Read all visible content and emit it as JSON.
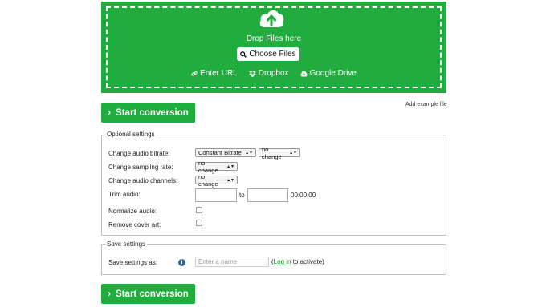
{
  "upload": {
    "drop_label": "Drop Files here",
    "choose_label": "Choose Files",
    "sources": [
      {
        "icon": "link-icon",
        "label": "Enter URL"
      },
      {
        "icon": "dropbox-icon",
        "label": "Dropbox"
      },
      {
        "icon": "google-drive-icon",
        "label": "Google Drive"
      }
    ]
  },
  "start_label": "Start conversion",
  "add_example_label": "Add example file",
  "optional": {
    "legend": "Optional settings",
    "bitrate_label": "Change audio bitrate:",
    "bitrate_mode": "Constant Bitrate",
    "bitrate_value": "no change",
    "sampling_label": "Change sampling rate:",
    "sampling_value": "no change",
    "channels_label": "Change audio channels:",
    "channels_value": "no change",
    "trim_label": "Trim audio:",
    "trim_to": "to",
    "trim_duration": "00:00:00",
    "normalize_label": "Normalize audio:",
    "remove_cover_label": "Remove cover art:"
  },
  "save": {
    "legend": "Save settings",
    "label": "Save settings as:",
    "placeholder": "Enter a name",
    "paren_open": "(",
    "login_label": "Log in",
    "after_login": " to activate)"
  },
  "colors": {
    "accent": "#20ad3e",
    "info": "#2d6aa3"
  }
}
